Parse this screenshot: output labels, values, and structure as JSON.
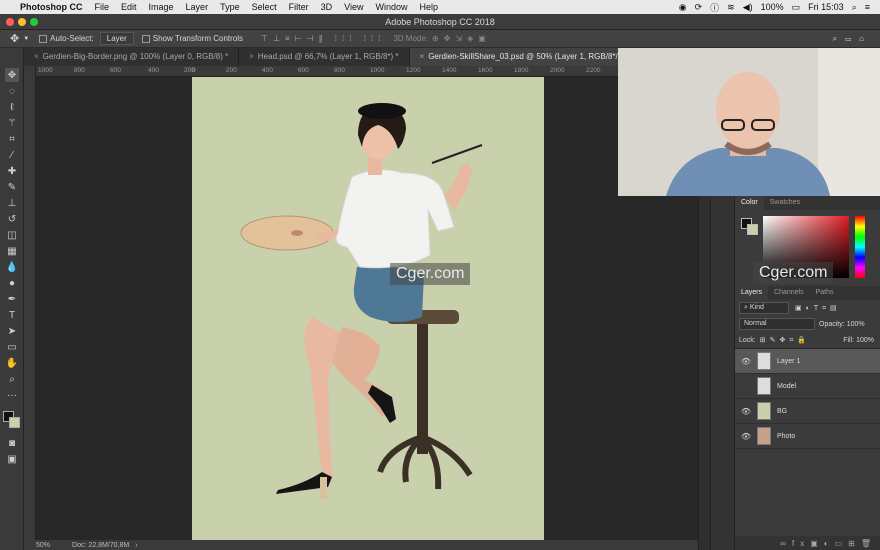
{
  "menubar": {
    "app_name": "Photoshop CC",
    "items": [
      "File",
      "Edit",
      "Image",
      "Layer",
      "Type",
      "Select",
      "Filter",
      "3D",
      "View",
      "Window",
      "Help"
    ],
    "battery": "100%",
    "clock": "Fri 15:03"
  },
  "window": {
    "title": "Adobe Photoshop CC 2018"
  },
  "options": {
    "auto_select_label": "Auto-Select:",
    "auto_select_value": "Layer",
    "transform_label": "Show Transform Controls",
    "mode_3d": "3D Mode:"
  },
  "tabs": [
    {
      "label": "Gerdien-Big-Border.png @ 100% (Layer 0, RGB/8) *"
    },
    {
      "label": "Head.psd @ 66,7% (Layer 1, RGB/8*) *"
    },
    {
      "label": "Gerdien-SkillShare_03.psd @ 50% (Layer 1, RGB/8*/CMYK) *"
    }
  ],
  "ruler": {
    "ticks": [
      "1000",
      "800",
      "600",
      "400",
      "200",
      "0",
      "200",
      "400",
      "600",
      "800",
      "1000",
      "1200",
      "1400",
      "1600",
      "1800",
      "2000",
      "2200",
      "2400",
      "2600"
    ]
  },
  "status": {
    "zoom": "50%",
    "doc": "Doc: 22,8M/70,8M"
  },
  "color_panel": {
    "tab_color": "Color",
    "tab_swatches": "Swatches"
  },
  "layers_panel": {
    "tabs": [
      "Layers",
      "Channels",
      "Paths"
    ],
    "kind": "Kind",
    "blend": "Normal",
    "opacity_label": "Opacity:",
    "opacity": "100%",
    "lock_label": "Lock:",
    "fill_label": "Fill:",
    "fill": "100%",
    "layers": [
      {
        "name": "Layer 1",
        "visible": true,
        "selected": true
      },
      {
        "name": "Model",
        "visible": false,
        "selected": false
      },
      {
        "name": "BG",
        "visible": true,
        "selected": false
      },
      {
        "name": "Photo",
        "visible": true,
        "selected": false
      }
    ]
  },
  "watermark": "Cger.com",
  "colors": {
    "canvas_bg": "#c8d0ac",
    "accent_red": "#ff5f57"
  }
}
